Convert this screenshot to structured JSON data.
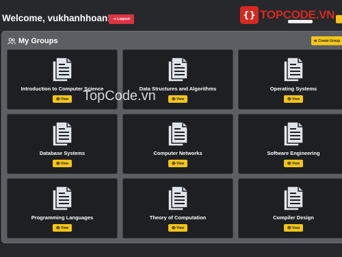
{
  "header": {
    "welcome": "Welcome, vukhanhhoan!",
    "logout_label": "Logout",
    "logo_mark": "{}",
    "logo_text": "TOPCODE.VN"
  },
  "groups": {
    "title": "My Groups",
    "create_label": "Create Group",
    "view_label": "View",
    "items": [
      {
        "name": "Introduction to Computer Science"
      },
      {
        "name": "Data Structures and Algorithms"
      },
      {
        "name": "Operating Systems"
      },
      {
        "name": "Database Systems"
      },
      {
        "name": "Computer Networks"
      },
      {
        "name": "Software Engineering"
      },
      {
        "name": "Programming Languages"
      },
      {
        "name": "Theory of Computation"
      },
      {
        "name": "Compiler Design"
      }
    ]
  },
  "watermark": "TopCode.vn",
  "colors": {
    "background": "#26282c",
    "panel": "#5b5e63",
    "card": "#1e1f22",
    "accent_yellow": "#f5c518",
    "logout_red": "#dc3545",
    "logo_red": "#d52a1f"
  }
}
